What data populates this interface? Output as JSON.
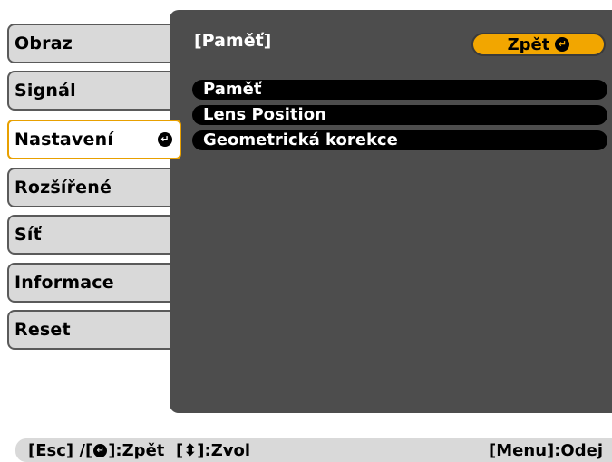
{
  "menu": {
    "items": [
      {
        "label": "Obraz"
      },
      {
        "label": "Signál"
      },
      {
        "label": "Nastavení",
        "active": true
      },
      {
        "label": "Rozšířené"
      },
      {
        "label": "Síť"
      },
      {
        "label": "Informace"
      },
      {
        "label": "Reset"
      }
    ]
  },
  "panel": {
    "title": "[Paměť]",
    "back_label": "Zpět",
    "items": [
      {
        "label": "Paměť"
      },
      {
        "label": "Lens Position"
      },
      {
        "label": "Geometrická korekce"
      }
    ]
  },
  "footer": {
    "esc": "[Esc] /[",
    "back": "]:Zpět",
    "select_open": "[",
    "select": "]:Zvol",
    "menu": "[Menu]:Odej"
  },
  "icons": {
    "enter": "enter-icon",
    "updown": "up-down-arrow-icon"
  },
  "colors": {
    "accent": "#f2a600",
    "panel": "#4d4d4d",
    "menu": "#d9d9d9"
  }
}
